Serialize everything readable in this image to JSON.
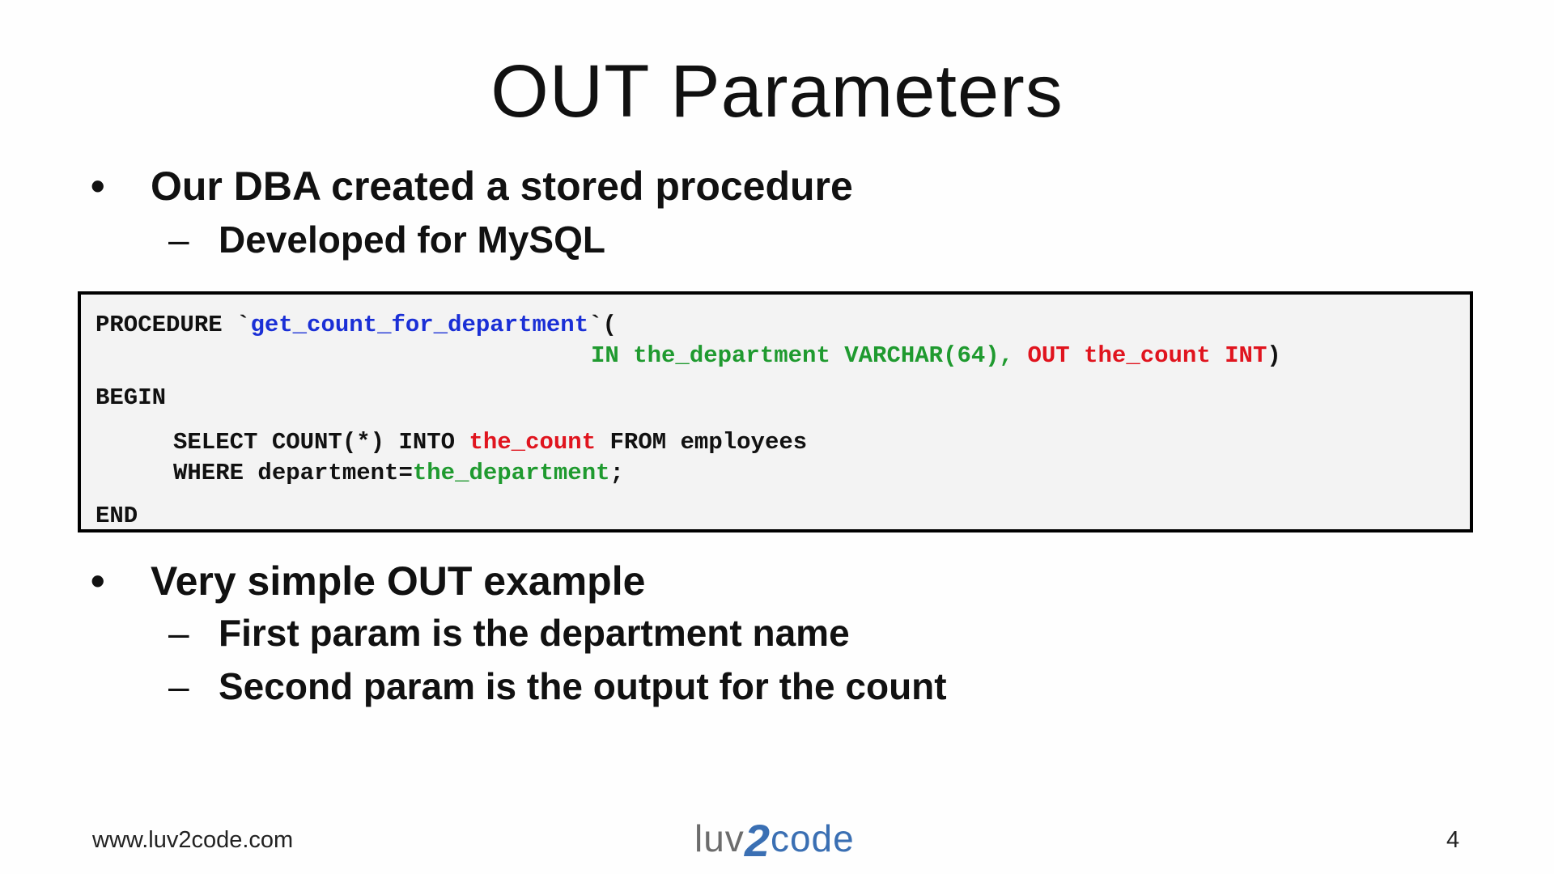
{
  "slide": {
    "title": "OUT Parameters",
    "bullets_top": {
      "main": "Our DBA created a stored procedure",
      "bullet_symbol": "•",
      "dash_symbol": "–",
      "sub": "Developed for MySQL"
    },
    "code": {
      "line1": {
        "keyword": "PROCEDURE ",
        "backtick_open": "`",
        "proc_name": "get_count_for_department",
        "backtick_close": "`("
      },
      "line2": {
        "in_part": "IN the_department VARCHAR(64), ",
        "out_part": "OUT the_count INT",
        "close": ")"
      },
      "line3": "BEGIN",
      "line4": {
        "pre": "SELECT COUNT(*) INTO ",
        "var": "the_count",
        "post": " FROM employees"
      },
      "line5": {
        "pre": "WHERE department=",
        "var": "the_department",
        "post": ";"
      },
      "line6": "END",
      "colors": {
        "proc_name": "#1a2fd6",
        "in_param": "#1f9a2f",
        "out_param": "#e0141e"
      }
    },
    "bullets_bottom": {
      "main": "Very simple OUT example",
      "sub1": "First param is the department name",
      "sub2": "Second param is the output for the count"
    },
    "footer": {
      "url": "www.luv2code.com",
      "logo_prefix": "luv",
      "logo_two": "2",
      "logo_suffix": "code",
      "page_number": "4"
    }
  }
}
